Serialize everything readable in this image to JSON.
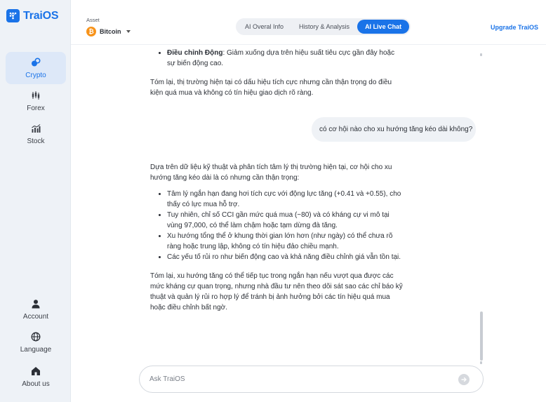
{
  "app": {
    "name": "TraiOS",
    "accent": "#1a73e8"
  },
  "sidebar": {
    "items": [
      {
        "label": "Crypto",
        "icon": "coins-icon",
        "active": true
      },
      {
        "label": "Forex",
        "icon": "candlestick-icon",
        "active": false
      },
      {
        "label": "Stock",
        "icon": "stock-chart-icon",
        "active": false
      }
    ],
    "bottom_items": [
      {
        "label": "Account",
        "icon": "user-icon"
      },
      {
        "label": "Language",
        "icon": "globe-icon"
      },
      {
        "label": "About us",
        "icon": "home-icon"
      }
    ]
  },
  "header": {
    "asset_label": "Asset",
    "asset_value": "Bitcoin",
    "tabs": [
      {
        "label": "AI Overal Info",
        "active": false
      },
      {
        "label": "History & Analysis",
        "active": false
      },
      {
        "label": "AI Live Chat",
        "active": true
      }
    ],
    "upgrade_label": "Upgrade TraiOS"
  },
  "chat": {
    "msg1_bullet_bold": "Điều chỉnh Động",
    "msg1_bullet_rest": ": Giảm xuống dựa trên hiệu suất tiêu cực gần đây hoặc sự biến động cao.",
    "msg1_summary": "Tóm lại, thị trường hiện tại có dấu hiệu tích cực nhưng cần thận trọng do điều kiện quá mua và không có tín hiệu giao dịch rõ ràng.",
    "user_question": "có cơ hội nào cho xu hướng tăng kéo dài không?",
    "msg2_intro": "Dựa trên dữ liệu kỹ thuật và phân tích tâm lý thị trường hiện tại, cơ hội cho xu hướng tăng kéo dài là có nhưng cần thận trọng:",
    "msg2_bullets": [
      "Tâm lý ngắn hạn đang hơi tích cực với động lực tăng (+0.41 và +0.55), cho thấy có lực mua hỗ trợ.",
      "Tuy nhiên, chỉ số CCI gần mức quá mua (~80) và có kháng cự vi mô tại vùng 97,000, có thể làm chậm hoặc tạm dừng đà tăng.",
      "Xu hướng tổng thể ở khung thời gian lớn hơn (như ngày) có thể chưa rõ ràng hoặc trung lập, không có tín hiệu đảo chiều mạnh.",
      "Các yếu tố rủi ro như biến động cao và khả năng điều chỉnh giá vẫn tồn tại."
    ],
    "msg2_summary": "Tóm lại, xu hướng tăng có thể tiếp tục trong ngắn hạn nếu vượt qua được các mức kháng cự quan trọng, nhưng nhà đầu tư nên theo dõi sát sao các chỉ báo kỹ thuật và quản lý rủi ro hợp lý để tránh bị ảnh hưởng bởi các tín hiệu quá mua hoặc điều chỉnh bất ngờ."
  },
  "input": {
    "placeholder": "Ask TraiOS",
    "value": ""
  }
}
